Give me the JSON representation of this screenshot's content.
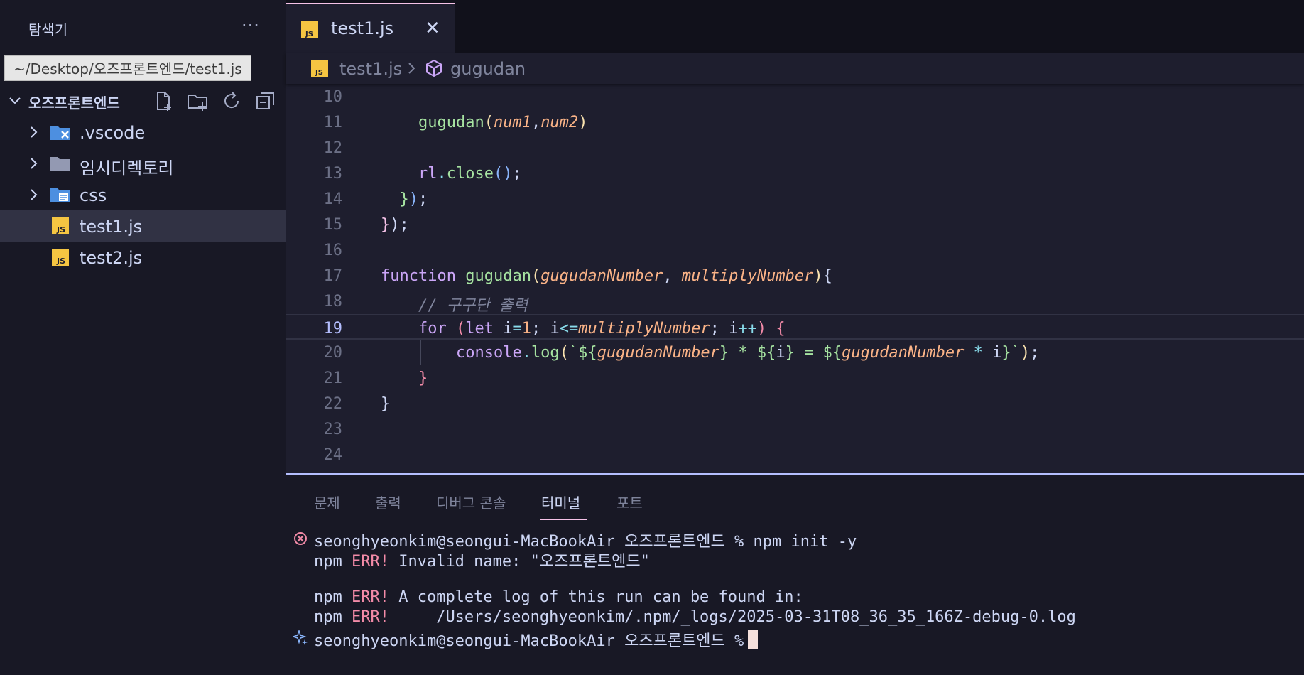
{
  "colors": {
    "accent": "#b4befe",
    "tab_indicator": "#f5c2e7",
    "js_icon": "#f5c542",
    "vscode_icon": "#4d8fe0",
    "error": "#f38ba8"
  },
  "sidebar": {
    "title": "탐색기",
    "more_icon": "ellipsis-icon",
    "path_tooltip": "~/Desktop/오즈프론트엔드/test1.js",
    "folder_name": "오즈프론트엔드",
    "actions": [
      "new-file-icon",
      "new-folder-icon",
      "refresh-icon",
      "collapse-all-icon"
    ],
    "items": [
      {
        "label": ".vscode",
        "type": "folder",
        "icon": "vscode-folder-icon"
      },
      {
        "label": "임시디렉토리",
        "type": "folder",
        "icon": "folder-icon"
      },
      {
        "label": "css",
        "type": "folder",
        "icon": "css-folder-icon"
      },
      {
        "label": "test1.js",
        "type": "file",
        "icon": "js-file-icon",
        "active": true
      },
      {
        "label": "test2.js",
        "type": "file",
        "icon": "js-file-icon"
      }
    ]
  },
  "editor": {
    "tab": {
      "label": "test1.js",
      "close_icon": "close-icon"
    },
    "breadcrumb": {
      "file": "test1.js",
      "symbol": "gugudan"
    },
    "current_line": 19,
    "line_numbers": [
      "10",
      "11",
      "12",
      "13",
      "14",
      "15",
      "16",
      "17",
      "18",
      "19",
      "20",
      "21",
      "22",
      "23",
      "24"
    ],
    "code": {
      "l11_fn": "gugudan",
      "l11_a1": "num1",
      "l11_a2": "num2",
      "l13_obj": "rl",
      "l13_m": "close",
      "l17_kw": "function",
      "l17_fn": "gugudan",
      "l17_p1": "gugudanNumber",
      "l17_p2": "multiplyNumber",
      "l18_comment": "// 구구단 출력",
      "l19_for": "for",
      "l19_let": "let",
      "l19_i": "i",
      "l19_one": "1",
      "l19_i2": "i",
      "l19_max": "multiplyNumber",
      "l19_i3": "i",
      "l20_obj": "console",
      "l20_m": "log",
      "l20_v1": "gugudanNumber",
      "l20_mul": " * ",
      "l20_v2": "i",
      "l20_eq": " = ",
      "l20_v3": "gugudanNumber",
      "l20_v4": "i"
    }
  },
  "panel": {
    "tabs": [
      "문제",
      "출력",
      "디버그 콘솔",
      "터미널",
      "포트"
    ],
    "active_tab": "터미널",
    "terminal": {
      "l1_prompt": "seonghyeonkim@seongui-MacBookAir 오즈프론트엔드 % npm init -y",
      "l2_pre": "npm ",
      "l2_err": "ERR!",
      "l2_msg": " Invalid name: \"오즈프론트엔드\"",
      "l4_pre": "npm ",
      "l4_err": "ERR!",
      "l4_msg": " A complete log of this run can be found in:",
      "l5_pre": "npm ",
      "l5_err": "ERR!",
      "l5_msg": "     /Users/seonghyeonkim/.npm/_logs/2025-03-31T08_36_35_166Z-debug-0.log",
      "l6_prompt": "seonghyeonkim@seongui-MacBookAir 오즈프론트엔드 %"
    }
  }
}
